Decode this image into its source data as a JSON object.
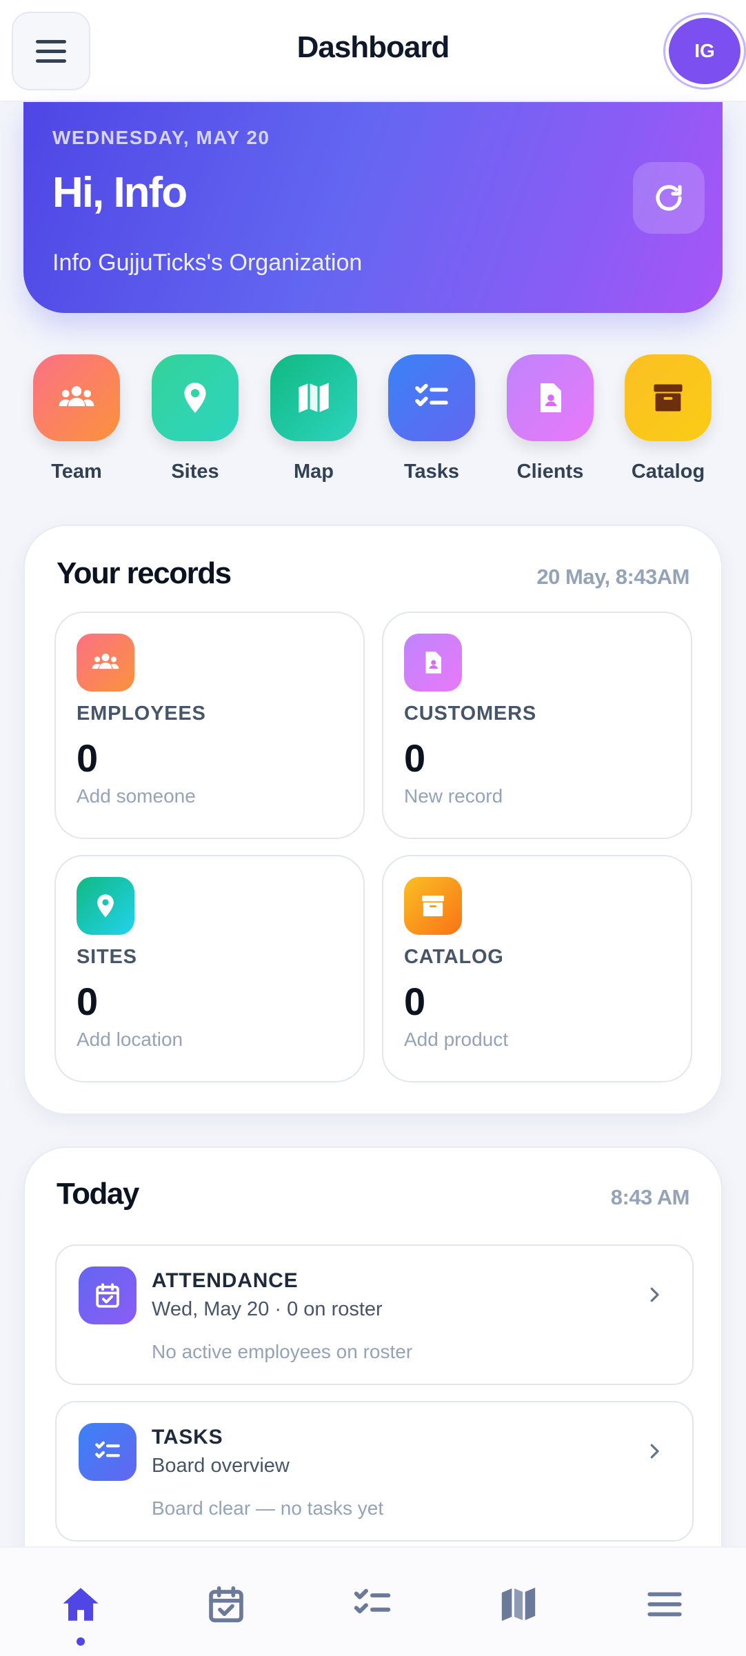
{
  "header": {
    "title": "Dashboard",
    "avatar_initials": "IG"
  },
  "hero": {
    "date": "WEDNESDAY, MAY 20",
    "greeting": "Hi, Info",
    "org": "Info GujjuTicks's Organization"
  },
  "quick_actions": [
    {
      "label": "Team",
      "icon": "team-icon",
      "color": "#fb7185"
    },
    {
      "label": "Sites",
      "icon": "location-pin-icon",
      "color": "#34d399"
    },
    {
      "label": "Map",
      "icon": "map-icon",
      "color": "#10b981"
    },
    {
      "label": "Tasks",
      "icon": "tasks-checklist-icon",
      "color": "#3b82f6"
    },
    {
      "label": "Clients",
      "icon": "contact-file-icon",
      "color": "#d946ef"
    },
    {
      "label": "Catalog",
      "icon": "archive-box-icon",
      "color": "#fbbf24"
    }
  ],
  "records": {
    "title": "Your records",
    "timestamp": "20 May, 8:43AM",
    "items": [
      {
        "label": "EMPLOYEES",
        "value": "0",
        "sub": "Add someone",
        "icon": "team-icon"
      },
      {
        "label": "CUSTOMERS",
        "value": "0",
        "sub": "New record",
        "icon": "contact-file-icon"
      },
      {
        "label": "SITES",
        "value": "0",
        "sub": "Add location",
        "icon": "location-pin-icon"
      },
      {
        "label": "CATALOG",
        "value": "0",
        "sub": "Add product",
        "icon": "archive-box-icon"
      }
    ]
  },
  "today": {
    "title": "Today",
    "time": "8:43 AM",
    "items": [
      {
        "title": "ATTENDANCE",
        "subtitle": "Wed, May 20 · 0 on roster",
        "note": "No active employees on roster",
        "icon": "calendar-check-icon"
      },
      {
        "title": "TASKS",
        "subtitle": "Board overview",
        "note": "Board clear — no tasks yet",
        "icon": "tasks-checklist-icon"
      }
    ]
  },
  "bottom_nav": [
    {
      "name": "home",
      "icon": "home-icon",
      "active": true
    },
    {
      "name": "attendance",
      "icon": "calendar-check-icon",
      "active": false
    },
    {
      "name": "tasks",
      "icon": "tasks-checklist-icon",
      "active": false
    },
    {
      "name": "map",
      "icon": "map-icon",
      "active": false
    },
    {
      "name": "menu",
      "icon": "menu-icon",
      "active": false
    }
  ],
  "colors": {
    "accent": "#4f46e5",
    "hero_start": "#4f46e5",
    "hero_end": "#a855f7",
    "muted": "#94a3b8"
  }
}
